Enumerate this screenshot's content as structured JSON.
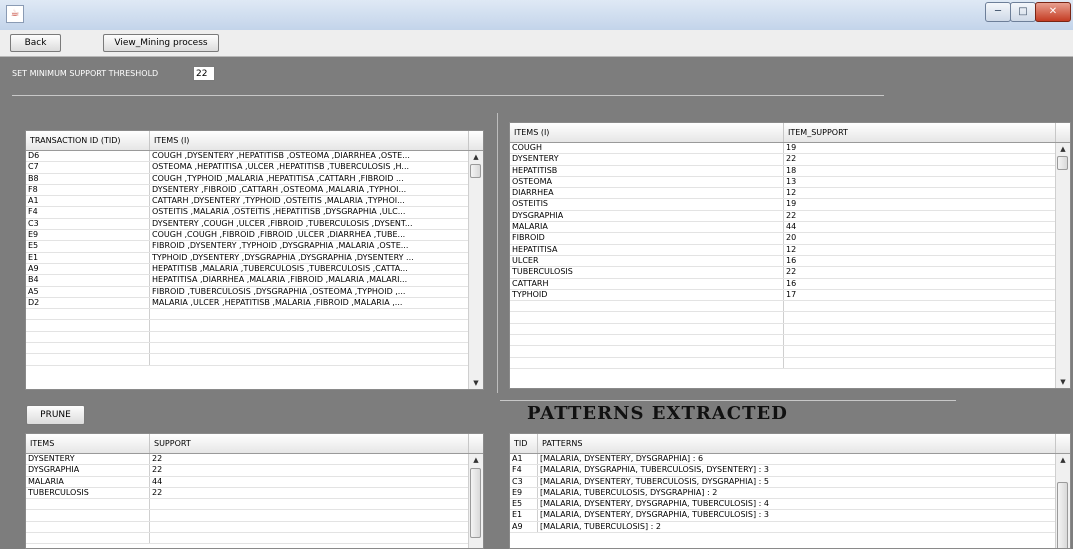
{
  "window": {
    "title": "",
    "icon": "java-icon",
    "buttons": {
      "minimize": "─",
      "maximize": "□",
      "close": "✕"
    }
  },
  "toolbar": {
    "back_label": "Back",
    "view_label": "View_Mining process"
  },
  "threshold": {
    "label": "SET MINIMUM SUPPORT THRESHOLD",
    "value": "22"
  },
  "transactions": {
    "columns": [
      "TRANSACTION ID (TID)",
      "ITEMS (I)"
    ],
    "rows": [
      [
        "D6",
        "COUGH ,DYSENTERY ,HEPATITISB ,OSTEOMA ,DIARRHEA ,OSTE..."
      ],
      [
        "C7",
        "OSTEOMA ,HEPATITISA ,ULCER ,HEPATITISB ,TUBERCULOSIS ,H..."
      ],
      [
        "B8",
        "COUGH ,TYPHOID ,MALARIA ,HEPATITISA ,CATTARH ,FIBROID ..."
      ],
      [
        "F8",
        "DYSENTERY ,FIBROID ,CATTARH ,OSTEOMA ,MALARIA ,TYPHOI..."
      ],
      [
        "A1",
        "CATTARH ,DYSENTERY ,TYPHOID ,OSTEITIS ,MALARIA ,TYPHOI..."
      ],
      [
        "F4",
        "OSTEITIS ,MALARIA ,OSTEITIS ,HEPATITISB ,DYSGRAPHIA ,ULC..."
      ],
      [
        "C3",
        "DYSENTERY ,COUGH ,ULCER ,FIBROID ,TUBERCULOSIS ,DYSENT..."
      ],
      [
        "E9",
        "COUGH ,COUGH ,FIBROID ,FIBROID ,ULCER ,DIARRHEA ,TUBE..."
      ],
      [
        "E5",
        "FIBROID ,DYSENTERY ,TYPHOID ,DYSGRAPHIA ,MALARIA ,OSTE..."
      ],
      [
        "E1",
        "TYPHOID ,DYSENTERY ,DYSGRAPHIA ,DYSGRAPHIA ,DYSENTERY ..."
      ],
      [
        "A9",
        "HEPATITISB ,MALARIA ,TUBERCULOSIS ,TUBERCULOSIS ,CATTA..."
      ],
      [
        "B4",
        "HEPATITISA ,DIARRHEA ,MALARIA ,FIBROID ,MALARIA ,MALARI..."
      ],
      [
        "A5",
        "FIBROID ,TUBERCULOSIS ,DYSGRAPHIA ,OSTEOMA ,TYPHOID ,..."
      ],
      [
        "D2",
        "MALARIA ,ULCER ,HEPATITISB ,MALARIA ,FIBROID ,MALARIA ,..."
      ],
      [
        "",
        ""
      ],
      [
        "",
        ""
      ],
      [
        "",
        ""
      ],
      [
        "",
        ""
      ],
      [
        "",
        ""
      ]
    ]
  },
  "item_support": {
    "columns": [
      "ITEMS (I)",
      "ITEM_SUPPORT"
    ],
    "rows": [
      [
        "COUGH",
        "19"
      ],
      [
        "DYSENTERY",
        "22"
      ],
      [
        "HEPATITISB",
        "18"
      ],
      [
        "OSTEOMA",
        "13"
      ],
      [
        "DIARRHEA",
        "12"
      ],
      [
        "OSTEITIS",
        "19"
      ],
      [
        "DYSGRAPHIA",
        "22"
      ],
      [
        "MALARIA",
        "44"
      ],
      [
        "FIBROID",
        "20"
      ],
      [
        "HEPATITISA",
        "12"
      ],
      [
        "ULCER",
        "16"
      ],
      [
        "TUBERCULOSIS",
        "22"
      ],
      [
        "CATTARH",
        "16"
      ],
      [
        "TYPHOID",
        "17"
      ],
      [
        "",
        ""
      ],
      [
        "",
        ""
      ],
      [
        "",
        ""
      ],
      [
        "",
        ""
      ],
      [
        "",
        ""
      ],
      [
        "",
        ""
      ]
    ]
  },
  "prune": {
    "button_label": "PRUNE"
  },
  "pruned": {
    "columns": [
      "ITEMS",
      "SUPPORT"
    ],
    "rows": [
      [
        "DYSENTERY",
        "22"
      ],
      [
        "DYSGRAPHIA",
        "22"
      ],
      [
        "MALARIA",
        "44"
      ],
      [
        "TUBERCULOSIS",
        "22"
      ],
      [
        "",
        ""
      ],
      [
        "",
        ""
      ],
      [
        "",
        ""
      ],
      [
        "",
        ""
      ]
    ]
  },
  "patterns": {
    "title": "PATTERNS EXTRACTED",
    "columns": [
      "TID",
      "PATTERNS"
    ],
    "rows": [
      [
        "A1",
        "[MALARIA, DYSENTERY, DYSGRAPHIA] : 6"
      ],
      [
        "F4",
        "[MALARIA, DYSGRAPHIA, TUBERCULOSIS, DYSENTERY] : 3"
      ],
      [
        "C3",
        "[MALARIA, DYSENTERY, TUBERCULOSIS, DYSGRAPHIA] : 5"
      ],
      [
        "E9",
        "[MALARIA, TUBERCULOSIS, DYSGRAPHIA] : 2"
      ],
      [
        "E5",
        "[MALARIA, DYSENTERY, DYSGRAPHIA, TUBERCULOSIS] : 4"
      ],
      [
        "E1",
        "[MALARIA, DYSENTERY, DYSGRAPHIA, TUBERCULOSIS] : 3"
      ],
      [
        "A9",
        "[MALARIA, TUBERCULOSIS] : 2"
      ]
    ]
  }
}
